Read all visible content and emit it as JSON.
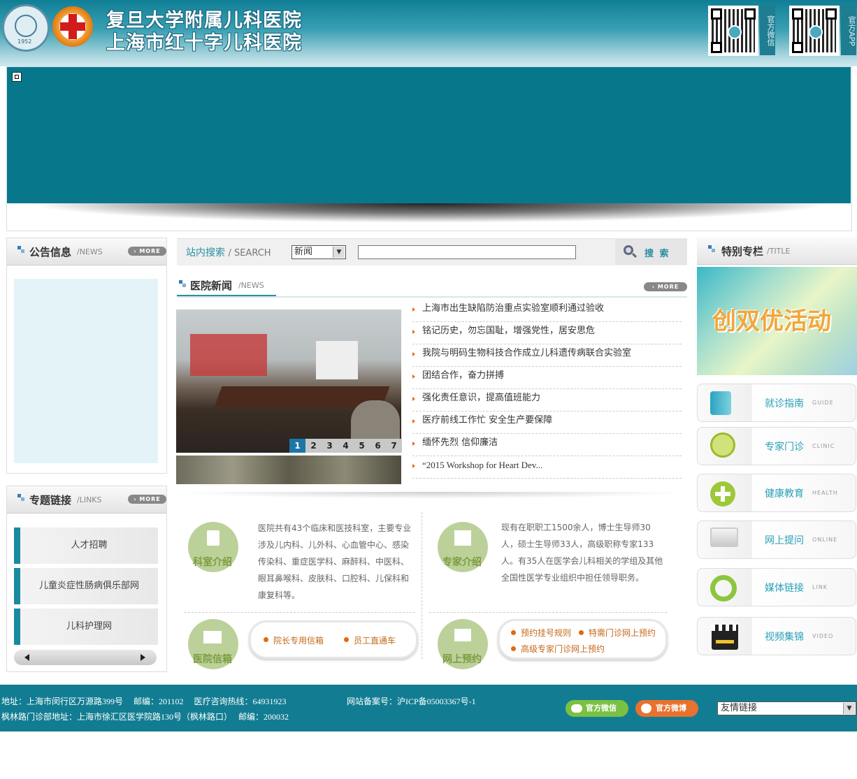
{
  "header": {
    "title_line1": "复旦大学附属儿科医院",
    "title_line2": "上海市红十字儿科医院",
    "logo_year": "1952",
    "qr_wechat_label": "官方微信",
    "qr_app_label": "官方APP"
  },
  "colors": {
    "teal": "#07788c",
    "footer": "#127d92",
    "accent_green": "#7c9d3e",
    "accent_orange": "#e06a10",
    "link_blue": "#28a0b8"
  },
  "announcements": {
    "title": "公告信息",
    "subtitle": "/NEWS",
    "more": "› MORE"
  },
  "topics": {
    "title": "专题链接",
    "subtitle": "/LINKS",
    "more": "› MORE",
    "items": [
      "人才招聘",
      "儿童炎症性肠病俱乐部网",
      "儿科护理网"
    ]
  },
  "search": {
    "title": "站内搜索",
    "subtitle": "/ SEARCH",
    "selected": "新闻",
    "button": "搜 索"
  },
  "news": {
    "title": "医院新闻",
    "subtitle": "/NEWS",
    "more": "› MORE",
    "pages": [
      "1",
      "2",
      "3",
      "4",
      "5",
      "6",
      "7"
    ],
    "items": [
      "上海市出生缺陷防治重点实验室顺利通过验收",
      "铭记历史，勿忘国耻，增强党性，居安思危",
      "我院与明码生物科技合作成立儿科遗传病联合实验室",
      "团结合作，奋力拼搏",
      "强化责任意识，提高值班能力",
      "医疗前线工作忙 安全生产要保障",
      "缅怀先烈 信仰廉洁",
      "“2015 Workshop for Heart Dev..."
    ]
  },
  "departments": {
    "label": "科室介绍",
    "text": "医院共有43个临床和医技科室，主要专业涉及儿内科、儿外科、心血管中心、感染传染科、重症医学科、麻醉科、中医科、眼耳鼻喉科、皮肤科、口腔科、儿保科和康复科等。"
  },
  "experts": {
    "label": "专家介绍",
    "text": "现有在职职工1500余人，博士生导师30人，硕士生导师33人，高级职称专家133人。有35人在医学会儿科相关的学组及其他全国性医学专业组织中担任领导职务。"
  },
  "mailbox": {
    "label": "医院信箱",
    "links": [
      "院长专用信箱",
      "员工直通车"
    ]
  },
  "booking": {
    "label": "网上预约",
    "links": [
      "预约挂号规则",
      "特需门诊网上预约",
      "高级专家门诊网上预约"
    ]
  },
  "special": {
    "title": "特别专栏",
    "subtitle": "/TITLE",
    "banner_text": "创双优活动",
    "cards": [
      {
        "title": "就诊指南",
        "en": "GUIDE"
      },
      {
        "title": "专家门诊",
        "en": "CLINIC"
      },
      {
        "title": "健康教育",
        "en": "HEALTH"
      },
      {
        "title": "网上提问",
        "en": "ONLINE"
      },
      {
        "title": "媒体链接",
        "en": "LINK"
      },
      {
        "title": "视频集锦",
        "en": "VIDEO"
      }
    ]
  },
  "footer": {
    "line1": "地址：上海市闵行区万源路399号　 邮编：201102　 医疗咨询热线：64931923",
    "icp": "网站备案号：沪ICP备05003367号-1",
    "line2": "枫林路门诊部地址：上海市徐汇区医学院路130号（枫林路口）　 邮编：200032",
    "wechat": "官方微信",
    "weibo": "官方微博",
    "friend_links": "友情链接"
  }
}
